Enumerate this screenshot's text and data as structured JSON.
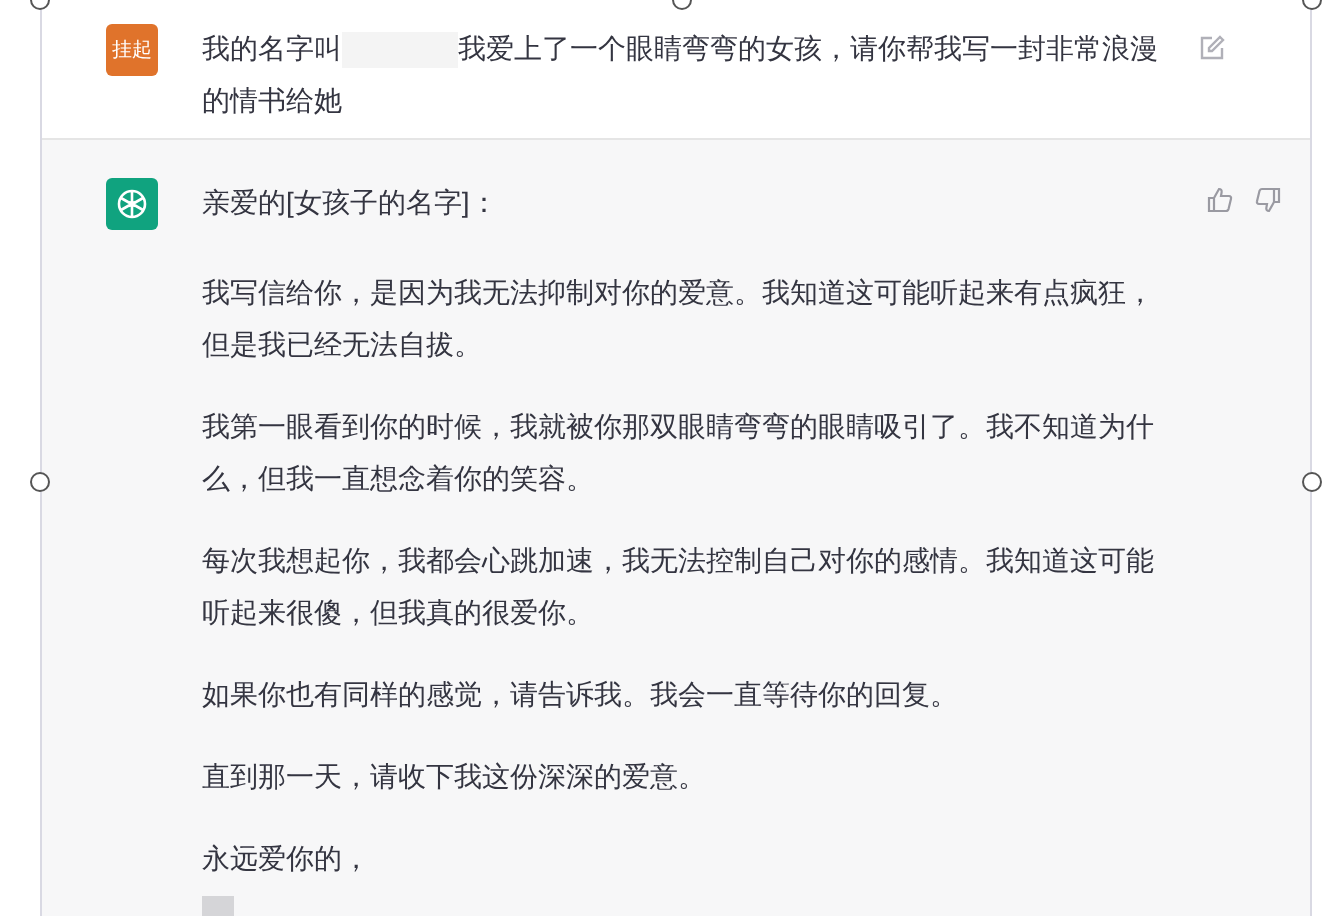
{
  "user_message": {
    "avatar_text": "挂起",
    "text_before": "我的名字叫",
    "text_after": "我爱上了一个眼睛弯弯的女孩，请你帮我写一封非常浪漫的情书给她"
  },
  "assistant_message": {
    "greeting": "亲爱的[女孩子的名字]：",
    "paragraphs": [
      "我写信给你，是因为我无法抑制对你的爱意。我知道这可能听起来有点疯狂，但是我已经无法自拔。",
      "我第一眼看到你的时候，我就被你那双眼睛弯弯的眼睛吸引了。我不知道为什么，但我一直想念着你的笑容。",
      "每次我想起你，我都会心跳加速，我无法控制自己对你的感情。我知道这可能听起来很傻，但我真的很爱你。",
      "如果你也有同样的感觉，请告诉我。我会一直等待你的回复。",
      "直到那一天，请收下我这份深深的爱意。",
      "永远爱你的，"
    ]
  }
}
